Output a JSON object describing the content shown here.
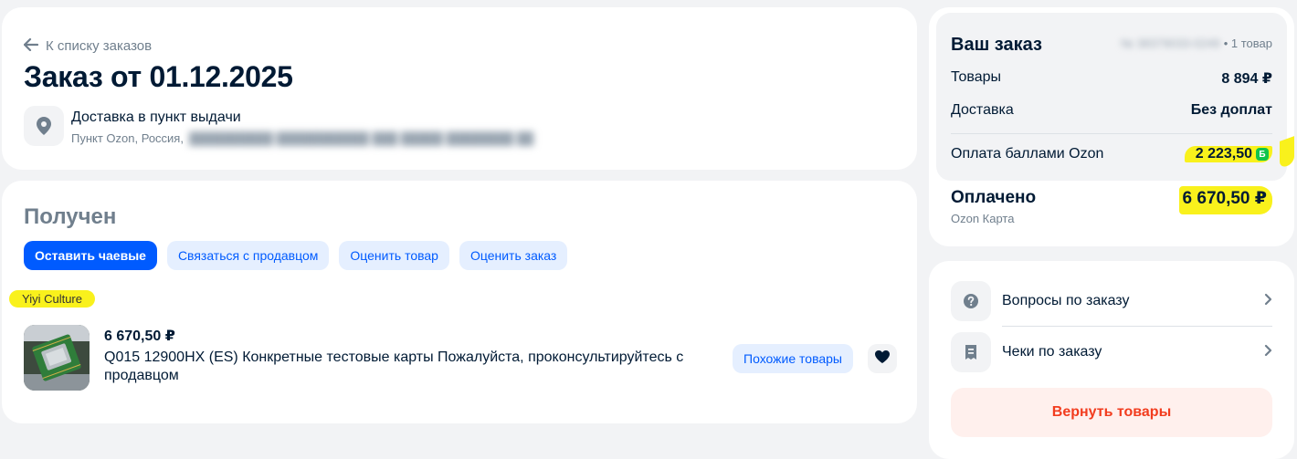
{
  "header": {
    "back_label": "К списку заказов",
    "title": "Заказ от 01.12.2025",
    "delivery_type": "Доставка в пункт выдачи",
    "delivery_point": "Пункт Ozon, Россия,"
  },
  "order": {
    "status": "Получен",
    "actions": [
      {
        "label": "Оставить чаевые",
        "style": "primary"
      },
      {
        "label": "Связаться с продавцом",
        "style": "light"
      },
      {
        "label": "Оценить товар",
        "style": "light"
      },
      {
        "label": "Оценить заказ",
        "style": "light"
      }
    ],
    "seller": "Yiyi Culture",
    "item": {
      "price": "6 670,50 ₽",
      "name": "Q015 12900HX (ES) Конкретные тестовые карты Пожалуйста, проконсультируйтесь с продавцом",
      "similar_label": "Похожие товары"
    }
  },
  "summary": {
    "title": "Ваш заказ",
    "item_count": "• 1 товар",
    "goods_label": "Товары",
    "goods_value": "8 894 ₽",
    "delivery_label": "Доставка",
    "delivery_value": "Без доплат",
    "points_label": "Оплата баллами Ozon",
    "points_value": "2 223,50",
    "points_badge": "Б",
    "paid_label": "Оплачено",
    "paid_method": "Ozon Карта",
    "paid_value": "6 670,50 ₽"
  },
  "links": {
    "questions": "Вопросы по заказу",
    "receipts": "Чеки по заказу",
    "return_label": "Вернуть товары"
  },
  "colors": {
    "accent": "#005bff",
    "accent_light": "#e5efff",
    "highlight": "#f9f11c",
    "danger": "#f23c1e",
    "muted": "#707f8d"
  }
}
